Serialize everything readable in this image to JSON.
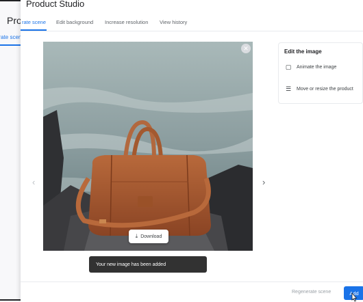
{
  "background_page": {
    "title": "Proc",
    "tab_fragment": "erate scen"
  },
  "app": {
    "title": "Product Studio"
  },
  "tabs": [
    {
      "label": "rate scene",
      "active": true
    },
    {
      "label": "Edit background",
      "active": false
    },
    {
      "label": "Increase resolution",
      "active": false
    },
    {
      "label": "View history",
      "active": false
    }
  ],
  "image": {
    "close_icon": "close-icon",
    "download_label": "Download",
    "download_icon": "download-icon",
    "prev_icon": "chevron-left-icon",
    "next_icon": "chevron-right-icon"
  },
  "edit_panel": {
    "title": "Edit the image",
    "items": [
      {
        "label": "Animate the image",
        "icon": "animate-icon"
      },
      {
        "label": "Move or resize the product",
        "icon": "move-resize-icon"
      }
    ]
  },
  "snackbar": {
    "message": "Your new image has been added"
  },
  "footer": {
    "regenerate_label": "Regenerate scene",
    "add_label": "Add"
  },
  "colors": {
    "accent": "#1a73e8",
    "snackbar_bg": "#323232",
    "bag": "#a85a32"
  }
}
